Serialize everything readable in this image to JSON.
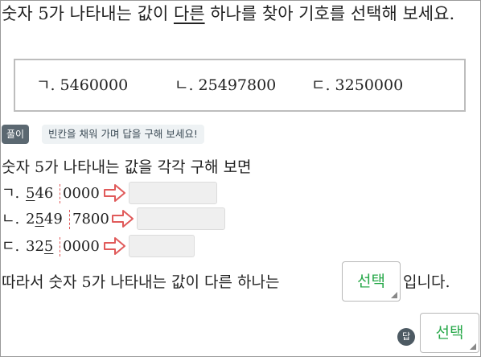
{
  "question": {
    "text_before": "숫자 5가 나타내는 값이 ",
    "underlined": "다른",
    "text_after": " 하나를 찾아 기호를 선택해 보세요."
  },
  "choices": [
    {
      "label": "ㄱ. 5460000"
    },
    {
      "label": "ㄴ. 25497800"
    },
    {
      "label": "ㄷ. 3250000"
    }
  ],
  "solution": {
    "tag": "풀이",
    "hint": "빈칸을 채워 가며 답을 구해 보세요!",
    "intro": "숫자 5가 나타내는 값을 각각 구해 보면",
    "rows": [
      {
        "label": "ㄱ.",
        "pre": "",
        "five": "5",
        "mid": "46",
        "rest": "0000",
        "blank": ""
      },
      {
        "label": "ㄴ.",
        "pre": "2",
        "five": "5",
        "mid": "49",
        "rest": "7800",
        "blank": ""
      },
      {
        "label": "ㄷ.",
        "pre": "32",
        "five": "5",
        "mid": "",
        "rest": "0000",
        "blank": ""
      }
    ],
    "conclusion_before": "따라서 숫자 5가 나타내는 값이 다른 하나는",
    "select_value": "선택",
    "conclusion_after": "입니다."
  },
  "answer": {
    "badge": "답",
    "select_value": "선택"
  },
  "colors": {
    "select_text": "#27a849",
    "arrow": "#e05a5a",
    "tag_bg": "#5b6871",
    "hint_bg": "#eef2f4"
  },
  "icons": {
    "arrow": "arrow-right-outline-icon",
    "caret": "dropdown-corner-icon"
  }
}
